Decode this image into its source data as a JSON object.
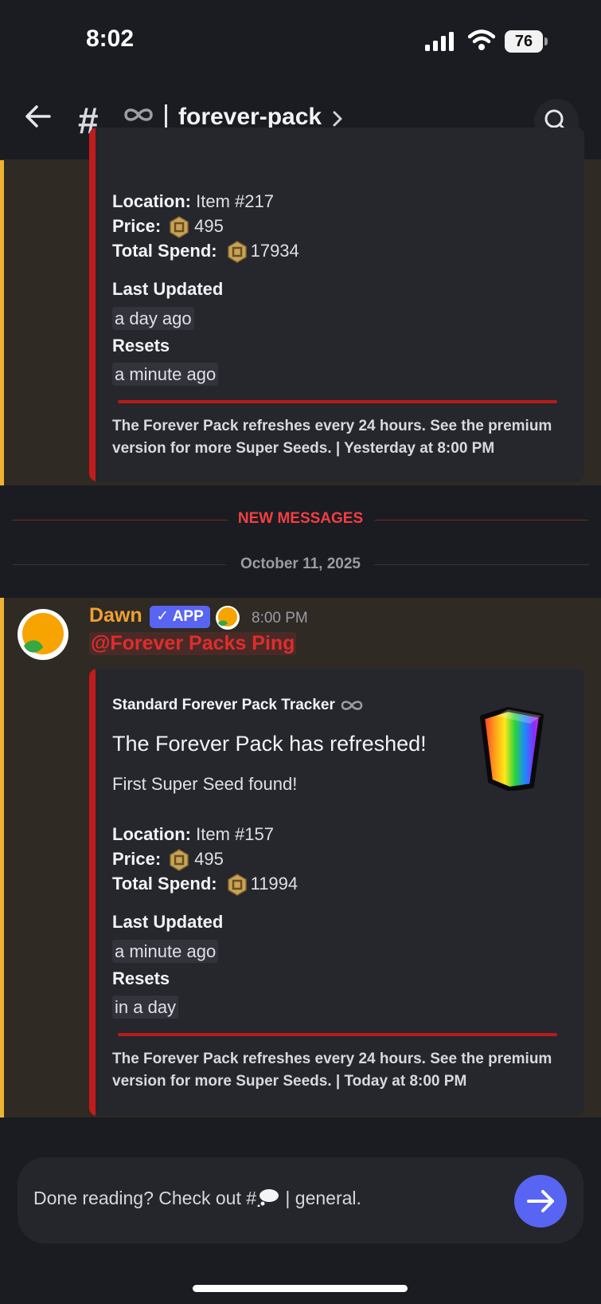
{
  "status_bar": {
    "time": "8:02",
    "battery": "76"
  },
  "header": {
    "hash": "#",
    "channel": "forever-pack"
  },
  "prev_embed": {
    "location_label": "Location:",
    "location_value": "Item #217",
    "price_label": "Price:",
    "price_value": "495",
    "spend_label": "Total Spend:",
    "spend_value": "17934",
    "updated_label": "Last Updated",
    "updated_value": "a day ago",
    "resets_label": "Resets",
    "resets_value": "a minute ago",
    "footer": "The Forever Pack refreshes every 24 hours. See the premium version for more Super Seeds. | Yesterday at 8:00 PM"
  },
  "new_messages_label": "NEW MESSAGES",
  "date_label": "October 11, 2025",
  "message": {
    "author": "Dawn",
    "badge": "✓ APP",
    "timestamp": "8:00 PM",
    "mention": "@Forever Packs Ping",
    "embed": {
      "author": "Standard Forever Pack Tracker",
      "title": "The Forever Pack has refreshed!",
      "description": "First Super Seed found!",
      "location_label": "Location:",
      "location_value": "Item #157",
      "price_label": "Price:",
      "price_value": "495",
      "spend_label": "Total Spend:",
      "spend_value": "11994",
      "updated_label": "Last Updated",
      "updated_value": "a minute ago",
      "resets_label": "Resets",
      "resets_value": "in a day",
      "footer": "The Forever Pack refreshes every 24 hours. See the premium version for more Super Seeds. | Today at 8:00 PM"
    }
  },
  "composer": {
    "prefix": "Done reading? Check out #",
    "suffix": "| general."
  },
  "colors": {
    "accent": "#5865f2",
    "embed_stripe": "#c11b1b",
    "highlight_bar": "#f0b232",
    "author": "#f0a030"
  }
}
